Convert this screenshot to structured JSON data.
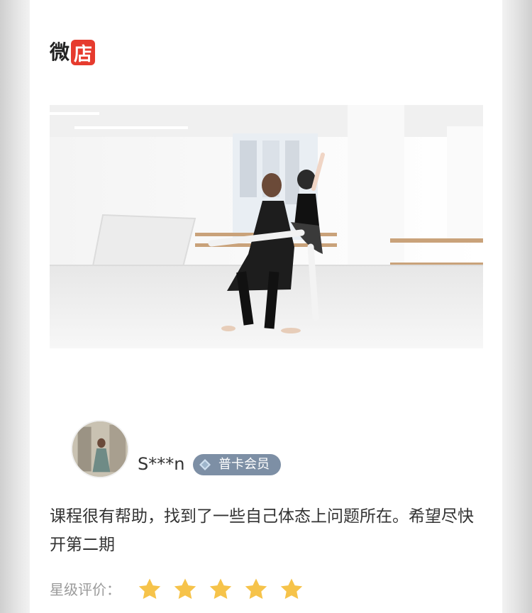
{
  "brand": {
    "text": "微",
    "badge": "店",
    "badge_color": "#e63b2e"
  },
  "post": {
    "photo": {
      "icon": "ballet-lesson-photo"
    }
  },
  "review": {
    "user": {
      "name": "S***n",
      "badge": "普卡会员",
      "avatar_icon": "user-avatar-photo"
    },
    "text": "课程很有帮助，找到了一些自己体态上问题所在。希望尽快开第二期",
    "rating_label": "星级评价：",
    "rating": 5,
    "rating_max": 5,
    "star_color": "#f6c34a"
  }
}
